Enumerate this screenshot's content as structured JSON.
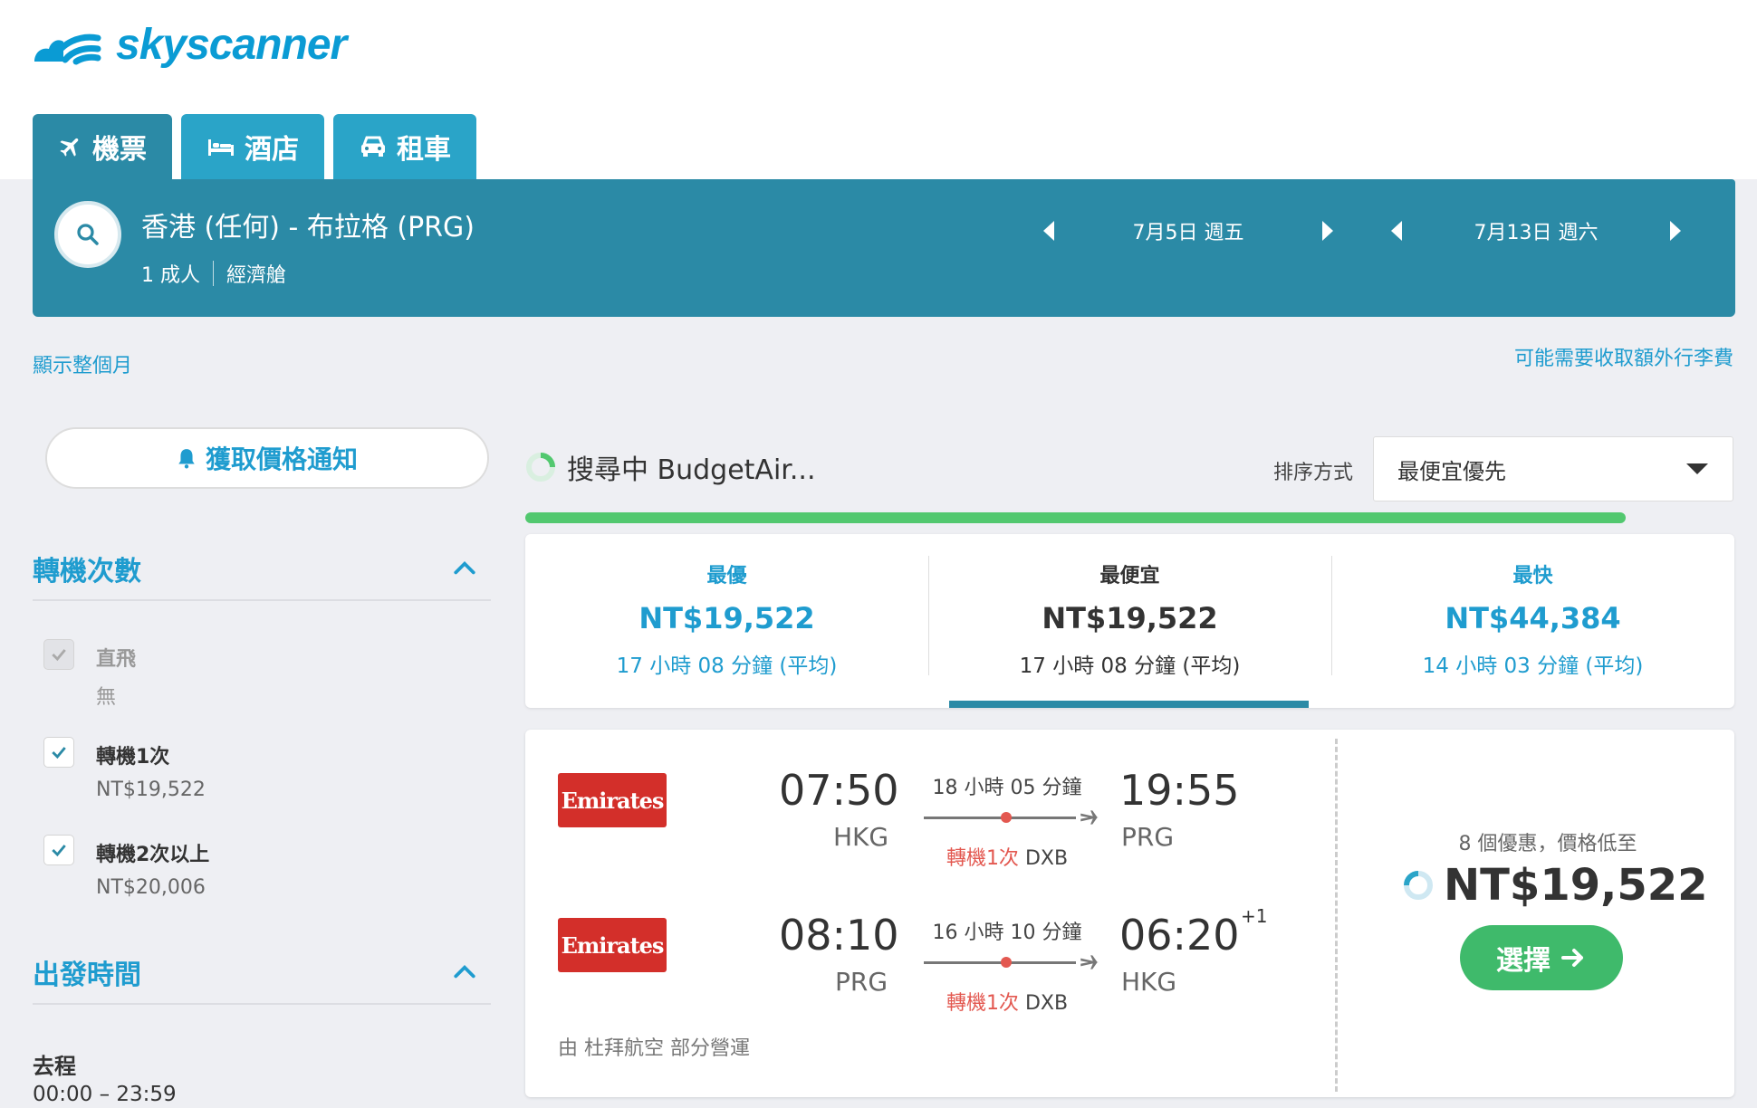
{
  "brand": {
    "name": "skyscanner",
    "color": "#0a9bd4"
  },
  "tabs": [
    {
      "label": "機票",
      "icon": "plane-icon",
      "active": true
    },
    {
      "label": "酒店",
      "icon": "bed-icon",
      "active": false
    },
    {
      "label": "租車",
      "icon": "car-icon",
      "active": false
    }
  ],
  "search": {
    "route": "香港 (任何) - 布拉格 (PRG)",
    "passengers": "1 成人",
    "cabin": "經濟艙",
    "depart_date": "7月5日 週五",
    "return_date": "7月13日 週六"
  },
  "links": {
    "show_month": "顯示整個月",
    "baggage_fee": "可能需要收取額外行李費"
  },
  "sidebar": {
    "alert_button": "獲取價格通知",
    "stops_title": "轉機次數",
    "stops": [
      {
        "label": "直飛",
        "sub": "無",
        "checked": true,
        "disabled": true
      },
      {
        "label": "轉機1次",
        "sub": "NT$19,522",
        "checked": true,
        "disabled": false
      },
      {
        "label": "轉機2次以上",
        "sub": "NT$20,006",
        "checked": true,
        "disabled": false
      }
    ],
    "depart_time_title": "出發時間",
    "outbound_label": "去程",
    "outbound_range": "00:00 – 23:59"
  },
  "results": {
    "status": "搜尋中 BudgetAir...",
    "sort_label": "排序方式",
    "sort_value": "最便宜優先",
    "progress": 0.91,
    "summary": [
      {
        "heading": "最優",
        "price": "NT$19,522",
        "duration": "17 小時 08 分鐘 (平均)"
      },
      {
        "heading": "最便宜",
        "price": "NT$19,522",
        "duration": "17 小時 08 分鐘 (平均)"
      },
      {
        "heading": "最快",
        "price": "NT$44,384",
        "duration": "14 小時 03 分鐘 (平均)"
      }
    ],
    "active_summary": 1,
    "card": {
      "legs": [
        {
          "airline": "Emirates",
          "dep_time": "07:50",
          "dep_apt": "HKG",
          "duration": "18 小時 05 分鐘",
          "stops": "轉機1次",
          "via": "DXB",
          "arr_time": "19:55",
          "arr_apt": "PRG",
          "plus_day": ""
        },
        {
          "airline": "Emirates",
          "dep_time": "08:10",
          "dep_apt": "PRG",
          "duration": "16 小時 10 分鐘",
          "stops": "轉機1次",
          "via": "DXB",
          "arr_time": "06:20",
          "arr_apt": "HKG",
          "plus_day": "+1"
        }
      ],
      "operated_by": "由 杜拜航空 部分營運",
      "deals": "8 個優惠，價格低至",
      "price": "NT$19,522",
      "select_label": "選擇"
    }
  },
  "colors": {
    "primary": "#2b8aa6",
    "tab": "#2aa4c8",
    "link": "#1f9ccf",
    "green": "#3fba6b",
    "stop_red": "#e35850",
    "emirates": "#d32f2a"
  }
}
